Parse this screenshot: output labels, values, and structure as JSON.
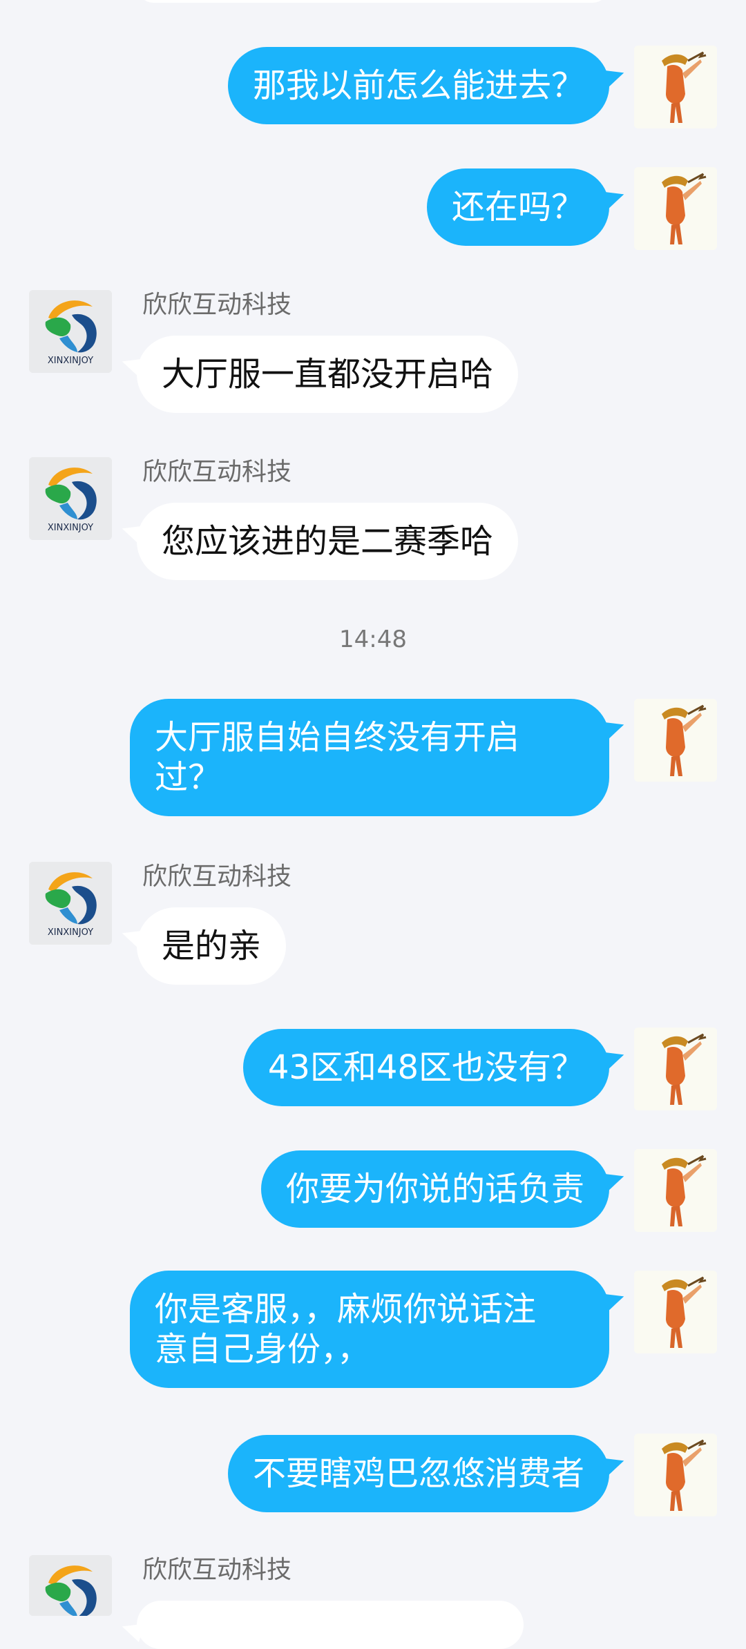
{
  "colors": {
    "background": "#f4f5f9",
    "outgoing_bubble": "#1bb4fb",
    "incoming_bubble": "#ffffff",
    "sender_name": "#6b6b6b"
  },
  "agent_logo_text": "XINXINJOY",
  "messages": [
    {
      "kind": "out",
      "text": "那我以前怎么能进去？"
    },
    {
      "kind": "out",
      "text": "还在吗？"
    },
    {
      "kind": "in",
      "sender": "欣欣互动科技",
      "text": "大厅服一直都没开启哈"
    },
    {
      "kind": "in",
      "sender": "欣欣互动科技",
      "text": "您应该进的是二赛季哈"
    },
    {
      "kind": "time",
      "text": "14:48"
    },
    {
      "kind": "out",
      "text": "大厅服自始自终没有开启\n过？"
    },
    {
      "kind": "in",
      "sender": "欣欣互动科技",
      "text": "是的亲"
    },
    {
      "kind": "out",
      "text": "43区和48区也没有？"
    },
    {
      "kind": "out",
      "text": "你要为你说的话负责"
    },
    {
      "kind": "out",
      "text": "你是客服，，麻烦你说话注\n意自己身份，，"
    },
    {
      "kind": "out",
      "text": "不要瞎鸡巴忽悠消费者"
    },
    {
      "kind": "in",
      "sender": "欣欣互动科技",
      "text": ""
    }
  ]
}
